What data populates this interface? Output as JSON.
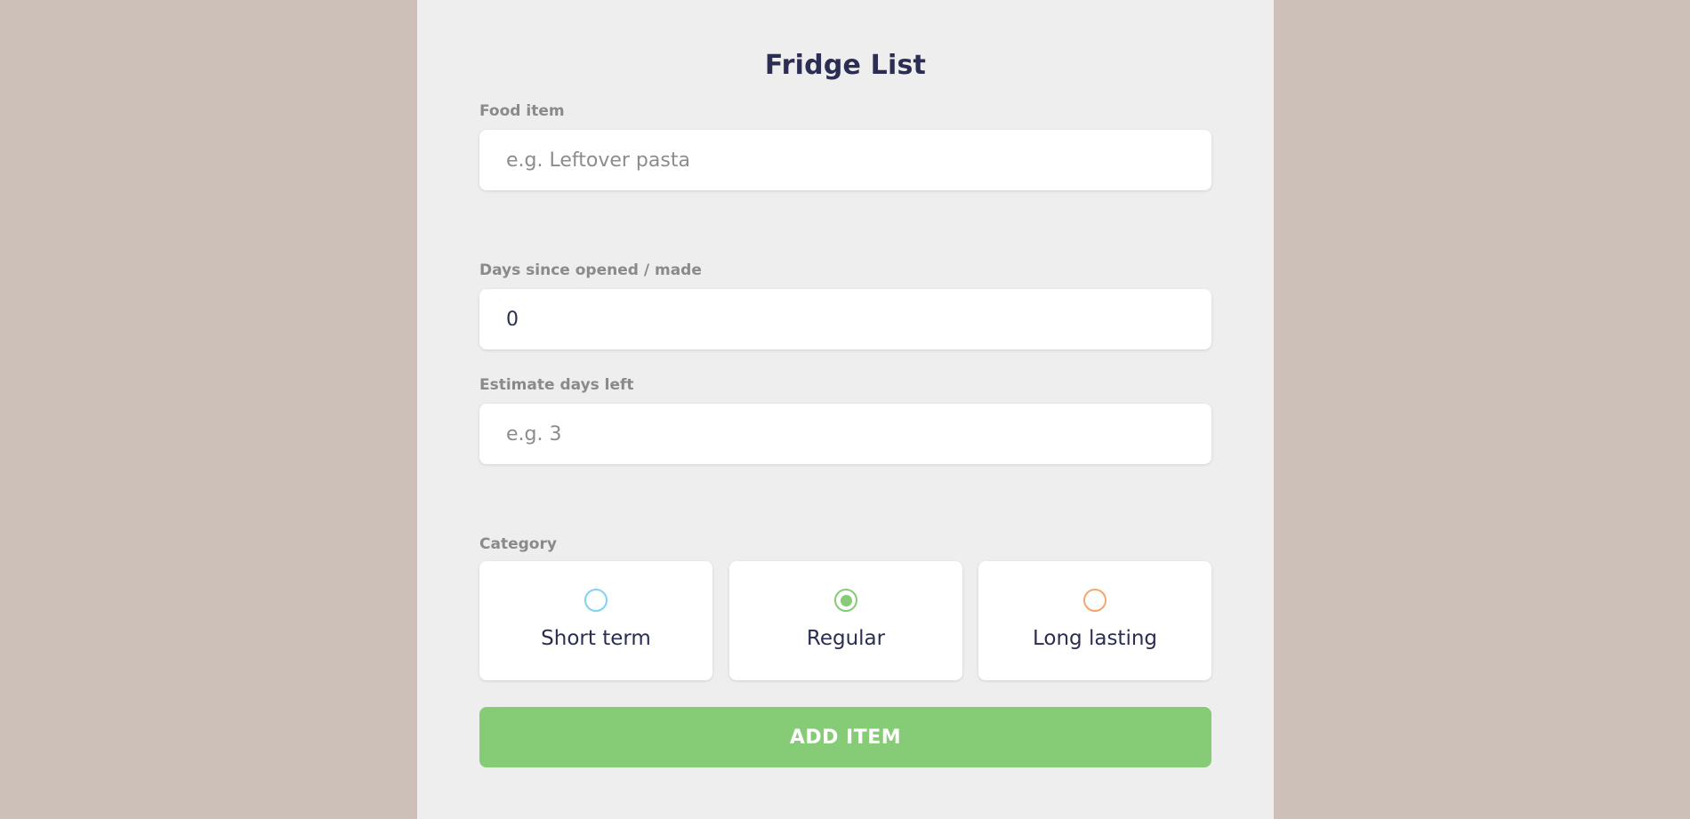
{
  "app": {
    "title": "Fridge List"
  },
  "form": {
    "food_item": {
      "label": "Food item",
      "value": "",
      "placeholder": "e.g. Leftover pasta"
    },
    "days_since_opened": {
      "label": "Days since opened / made",
      "value": "0",
      "placeholder": ""
    },
    "estimate_days_left": {
      "label": "Estimate days left",
      "value": "",
      "placeholder": "e.g. 3"
    },
    "category": {
      "label": "Category",
      "selected": "Regular",
      "options": [
        {
          "label": "Short term",
          "color": "#7fd3f0",
          "selected": false,
          "icon": "radio-unselected"
        },
        {
          "label": "Regular",
          "color": "#86cb75",
          "selected": true,
          "icon": "radio-selected"
        },
        {
          "label": "Long lasting",
          "color": "#f6a56b",
          "selected": false,
          "icon": "radio-unselected"
        }
      ]
    },
    "submit_label": "ADD ITEM"
  },
  "colors": {
    "page_background": "#cdc0b8",
    "panel_background": "#eeeeee",
    "title_color": "#2b2d52",
    "label_color": "#8a8a8a",
    "accent_green": "#86cb75"
  }
}
